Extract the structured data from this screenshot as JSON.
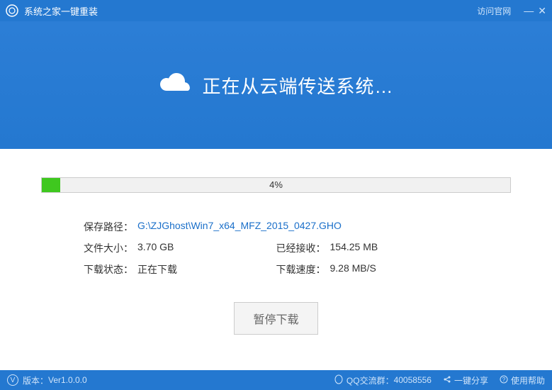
{
  "titlebar": {
    "app_title": "系统之家一键重装",
    "official_link": "访问官网"
  },
  "hero": {
    "headline": "正在从云端传送系统…"
  },
  "progress": {
    "percent_text": "4%",
    "percent_value": 4
  },
  "info": {
    "save_path_label": "保存路径：",
    "save_path_value": "G:\\ZJGhost\\Win7_x64_MFZ_2015_0427.GHO",
    "file_size_label": "文件大小：",
    "file_size_value": "3.70 GB",
    "received_label": "已经接收：",
    "received_value": "154.25 MB",
    "status_label": "下载状态：",
    "status_value": "正在下载",
    "speed_label": "下载速度：",
    "speed_value": "9.28 MB/S"
  },
  "buttons": {
    "pause": "暂停下载"
  },
  "footer": {
    "version_label": "版本：",
    "version_value": "Ver1.0.0.0",
    "qq_label": "QQ交流群：",
    "qq_value": "40058556",
    "share": "一键分享",
    "help": "使用帮助"
  }
}
